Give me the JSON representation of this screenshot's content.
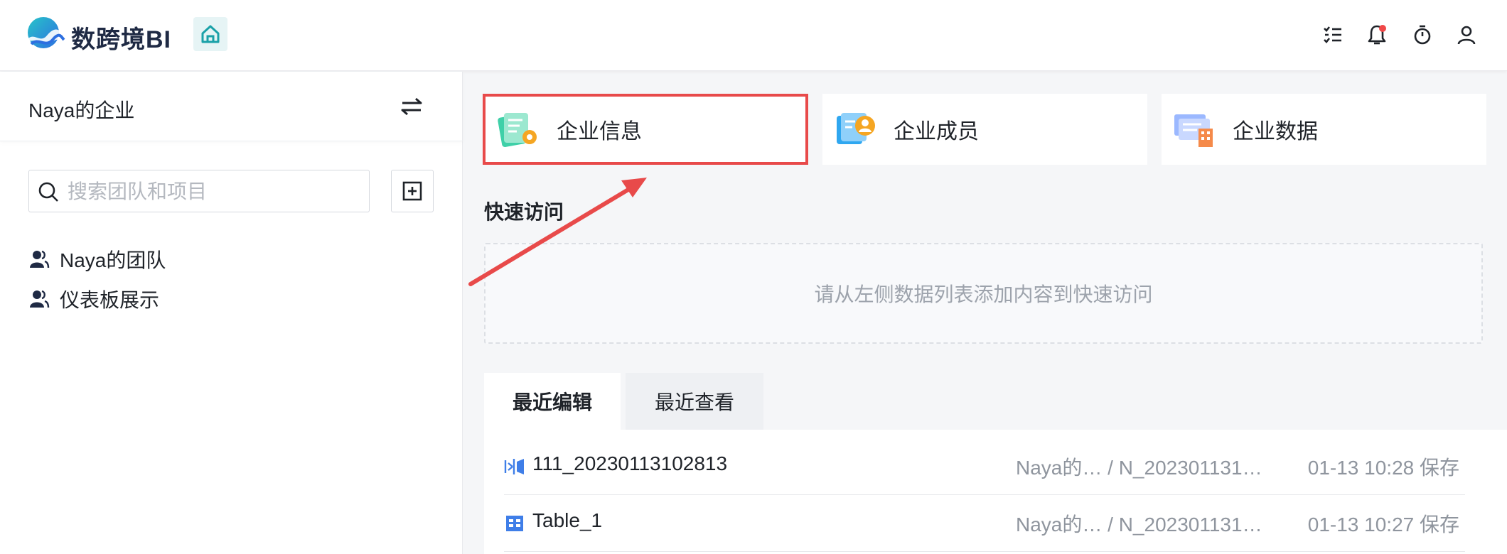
{
  "header": {
    "brand": "数跨境BI",
    "icons": [
      "list-icon",
      "bell-icon",
      "timer-icon",
      "user-icon"
    ],
    "colors": {
      "accent": "#1aa1a8",
      "notification": "#f04848"
    }
  },
  "sidebar": {
    "enterprise": "Naya的企业",
    "search_placeholder": "搜索团队和项目",
    "teams": [
      {
        "label": "Naya的团队"
      },
      {
        "label": "仪表板展示"
      }
    ]
  },
  "cards": [
    {
      "label": "企业信息"
    },
    {
      "label": "企业成员"
    },
    {
      "label": "企业数据"
    }
  ],
  "quick_access": {
    "title": "快速访问",
    "hint": "请从左侧数据列表添加内容到快速访问"
  },
  "tabs": [
    {
      "label": "最近编辑"
    },
    {
      "label": "最近查看"
    }
  ],
  "recent": [
    {
      "name": "111_20230113102813",
      "team": "Naya的…",
      "project": "/ N_202301131…",
      "time": "01-13 10:28 保存"
    },
    {
      "name": "Table_1",
      "team": "Naya的…",
      "project": "/ N_202301131…",
      "time": "01-13 10:27 保存"
    }
  ]
}
